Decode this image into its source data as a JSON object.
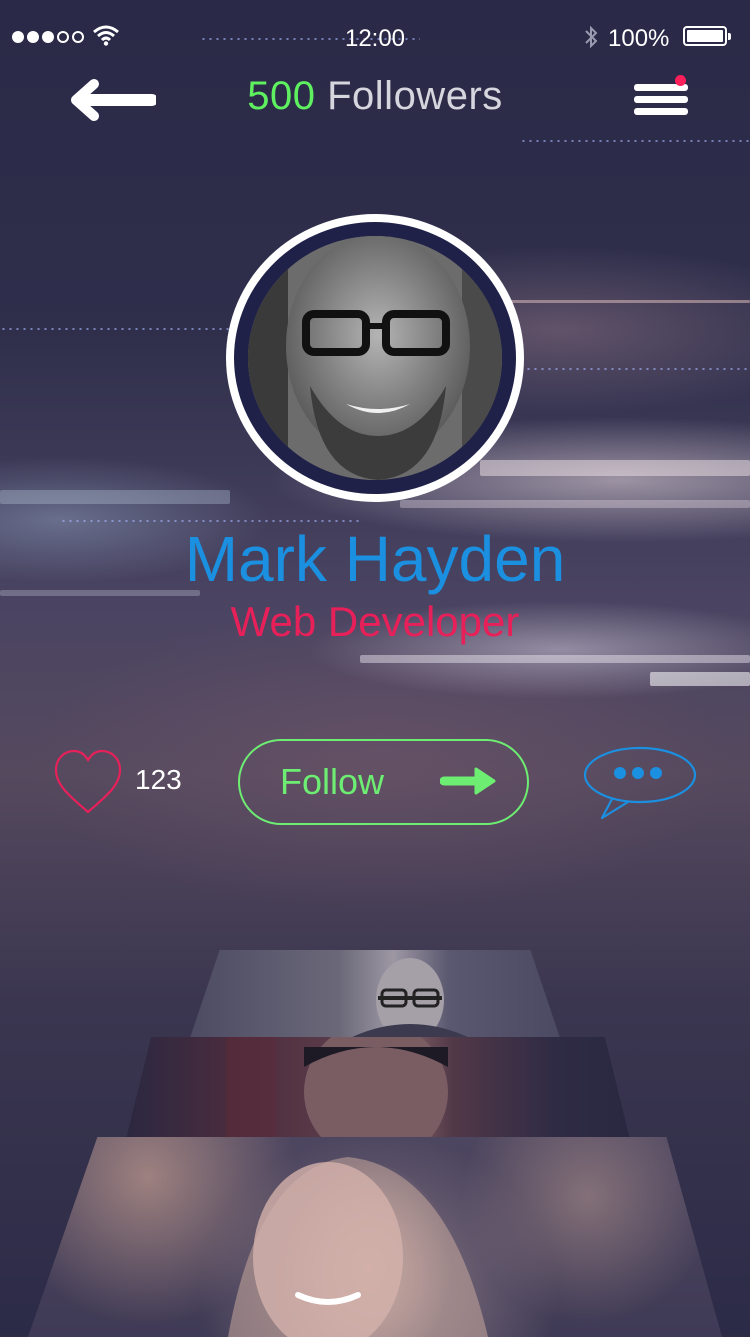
{
  "status_bar": {
    "time": "12:00",
    "battery": "100%",
    "signal_bars_filled": 3,
    "signal_bars_total": 5
  },
  "header": {
    "follower_count": "500",
    "followers_label": "Followers",
    "back_icon": "arrow-left-icon",
    "menu_icon": "hamburger-menu-icon",
    "has_notification": true
  },
  "profile": {
    "name": "Mark Hayden",
    "role": "Web Developer"
  },
  "actions": {
    "like_count": "123",
    "follow_label": "Follow",
    "like_icon": "heart-icon",
    "follow_icon": "arrow-right-icon",
    "chat_icon": "chat-bubble-icon"
  },
  "colors": {
    "accent_green": "#6dee72",
    "accent_blue": "#1b8fe0",
    "accent_pink": "#e8205a",
    "notification": "#ff1f5a"
  }
}
